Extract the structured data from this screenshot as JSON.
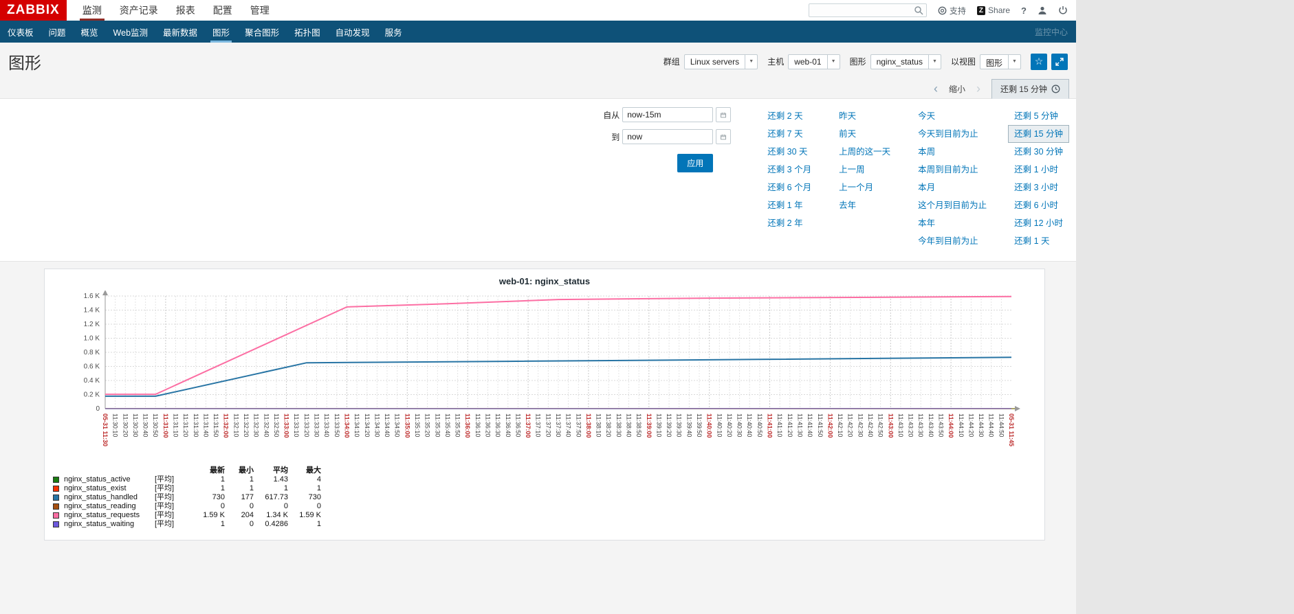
{
  "icons": {
    "dropdown_arrow": "▼",
    "chevron_left": "‹",
    "chevron_right": "›",
    "star": "☆",
    "help": "?"
  },
  "topbar": {
    "logo": "ZABBIX",
    "menu": [
      {
        "label": "监测",
        "active": true
      },
      {
        "label": "资产记录",
        "active": false
      },
      {
        "label": "报表",
        "active": false
      },
      {
        "label": "配置",
        "active": false
      },
      {
        "label": "管理",
        "active": false
      }
    ],
    "search_value": "",
    "support_label": "支持",
    "share_label": "Share",
    "share_badge": "Z"
  },
  "subnav": {
    "items": [
      {
        "label": "仪表板",
        "active": false
      },
      {
        "label": "问题",
        "active": false
      },
      {
        "label": "概览",
        "active": false
      },
      {
        "label": "Web监测",
        "active": false
      },
      {
        "label": "最新数据",
        "active": false
      },
      {
        "label": "图形",
        "active": true
      },
      {
        "label": "聚合图形",
        "active": false
      },
      {
        "label": "拓扑图",
        "active": false
      },
      {
        "label": "自动发现",
        "active": false
      },
      {
        "label": "服务",
        "active": false
      }
    ],
    "right_label": "监控中心"
  },
  "page_header": {
    "title": "图形",
    "filters": [
      {
        "label": "群组",
        "value": "Linux servers"
      },
      {
        "label": "主机",
        "value": "web-01"
      },
      {
        "label": "图形",
        "value": "nginx_status"
      },
      {
        "label": "以视图",
        "value": "图形"
      }
    ]
  },
  "timebar": {
    "zoom_out": "缩小",
    "range_tab": "还剩 15 分钟"
  },
  "time_filter": {
    "from_label": "自从",
    "from_value": "now-15m",
    "to_label": "到",
    "to_value": "now",
    "apply_label": "应用",
    "selected": "还剩 15 分钟",
    "columns": [
      [
        "还剩 2 天",
        "还剩 7 天",
        "还剩 30 天",
        "还剩 3 个月",
        "还剩 6 个月",
        "还剩 1 年",
        "还剩 2 年"
      ],
      [
        "昨天",
        "前天",
        "上周的这一天",
        "上一周",
        "上一个月",
        "去年"
      ],
      [
        "今天",
        "今天到目前为止",
        "本周",
        "本周到目前为止",
        "本月",
        "这个月到目前为止",
        "本年",
        "今年到目前为止"
      ],
      [
        "还剩 5 分钟",
        "还剩 15 分钟",
        "还剩 30 分钟",
        "还剩 1 小时",
        "还剩 3 小时",
        "还剩 6 小时",
        "还剩 12 小时",
        "还剩 1 天"
      ]
    ]
  },
  "chart_data": {
    "type": "line",
    "title": "web-01: nginx_status",
    "ylim": [
      0,
      1600
    ],
    "y_tick_step": 200,
    "y_ticks": [
      "0",
      "0.2 K",
      "0.4 K",
      "0.6 K",
      "0.8 K",
      "1.0 K",
      "1.2 K",
      "1.4 K",
      "1.6 K"
    ],
    "x_axis": {
      "start": "11:30:00",
      "step_seconds": 10,
      "total_seconds": 900,
      "major_every_seconds": 60,
      "date_prefix": "05-31",
      "first_label": "05-31 11:30",
      "last_label": "05-31 11:45"
    },
    "series": [
      {
        "name": "nginx_status_active",
        "color": "#1A7C11",
        "width": 1,
        "points": [
          [
            0,
            1
          ],
          [
            900,
            1
          ]
        ]
      },
      {
        "name": "nginx_status_exist",
        "color": "#F63100",
        "width": 1,
        "points": [
          [
            0,
            1
          ],
          [
            900,
            1
          ]
        ]
      },
      {
        "name": "nginx_status_handled",
        "color": "#2774A4",
        "width": 2,
        "points": [
          [
            0,
            177
          ],
          [
            50,
            177
          ],
          [
            200,
            652
          ],
          [
            400,
            672
          ],
          [
            650,
            700
          ],
          [
            900,
            730
          ]
        ]
      },
      {
        "name": "nginx_status_reading",
        "color": "#A54F10",
        "width": 1,
        "points": [
          [
            0,
            0
          ],
          [
            900,
            0
          ]
        ]
      },
      {
        "name": "nginx_status_requests",
        "color": "#FC6EA3",
        "width": 2,
        "points": [
          [
            0,
            204
          ],
          [
            50,
            204
          ],
          [
            240,
            1445
          ],
          [
            340,
            1490
          ],
          [
            450,
            1550
          ],
          [
            600,
            1570
          ],
          [
            900,
            1592
          ]
        ]
      },
      {
        "name": "nginx_status_waiting",
        "color": "#6C59DC",
        "width": 1,
        "points": [
          [
            0,
            0
          ],
          [
            900,
            1
          ]
        ]
      }
    ],
    "legend": {
      "headers": [
        "最新",
        "最小",
        "平均",
        "最大"
      ],
      "rows": [
        {
          "name": "nginx_status_active",
          "color": "#1A7C11",
          "func": "[平均]",
          "last": "1",
          "min": "1",
          "avg": "1.43",
          "max": "4"
        },
        {
          "name": "nginx_status_exist",
          "color": "#F63100",
          "func": "[平均]",
          "last": "1",
          "min": "1",
          "avg": "1",
          "max": "1"
        },
        {
          "name": "nginx_status_handled",
          "color": "#2774A4",
          "func": "[平均]",
          "last": "730",
          "min": "177",
          "avg": "617.73",
          "max": "730"
        },
        {
          "name": "nginx_status_reading",
          "color": "#A54F10",
          "func": "[平均]",
          "last": "0",
          "min": "0",
          "avg": "0",
          "max": "0"
        },
        {
          "name": "nginx_status_requests",
          "color": "#FC6EA3",
          "func": "[平均]",
          "last": "1.59 K",
          "min": "204",
          "avg": "1.34 K",
          "max": "1.59 K"
        },
        {
          "name": "nginx_status_waiting",
          "color": "#6C59DC",
          "func": "[平均]",
          "last": "1",
          "min": "0",
          "avg": "0.4286",
          "max": "1"
        }
      ]
    }
  }
}
